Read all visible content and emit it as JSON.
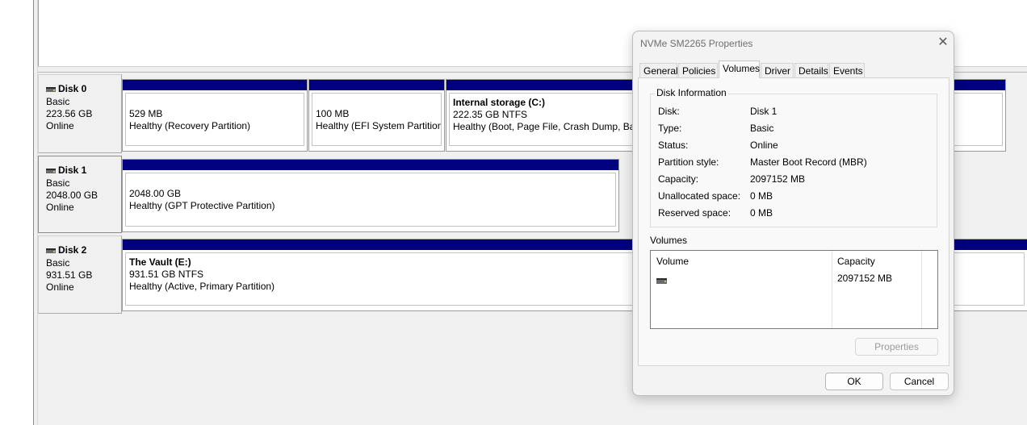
{
  "disks": [
    {
      "name": "Disk 0",
      "type": "Basic",
      "size": "223.56 GB",
      "status": "Online",
      "partitions": [
        {
          "title": "",
          "size": "529 MB",
          "status": "Healthy (Recovery Partition)"
        },
        {
          "title": "",
          "size": "100 MB",
          "status": "Healthy (EFI System Partition)"
        },
        {
          "title": "Internal storage  (C:)",
          "size": "222.35 GB NTFS",
          "status": "Healthy (Boot, Page File, Crash Dump, Basi"
        }
      ]
    },
    {
      "name": "Disk 1",
      "type": "Basic",
      "size": "2048.00 GB",
      "status": "Online",
      "partitions": [
        {
          "title": "",
          "size": "2048.00 GB",
          "status": "Healthy (GPT Protective Partition)"
        }
      ]
    },
    {
      "name": "Disk 2",
      "type": "Basic",
      "size": "931.51 GB",
      "status": "Online",
      "partitions": [
        {
          "title": "The Vault  (E:)",
          "size": "931.51 GB NTFS",
          "status": "Healthy (Active, Primary Partition)"
        }
      ]
    }
  ],
  "dialog": {
    "title": "NVMe SM2265 Properties",
    "close_glyph": "✕",
    "tabs": [
      "General",
      "Policies",
      "Volumes",
      "Driver",
      "Details",
      "Events"
    ],
    "active_tab": "Volumes",
    "disk_info": {
      "group_title": "Disk Information",
      "rows": [
        {
          "label": "Disk:",
          "value": "Disk 1"
        },
        {
          "label": "Type:",
          "value": "Basic"
        },
        {
          "label": "Status:",
          "value": "Online"
        },
        {
          "label": "Partition style:",
          "value": "Master Boot Record (MBR)"
        },
        {
          "label": "Capacity:",
          "value": "2097152 MB"
        },
        {
          "label": "Unallocated space:",
          "value": "0 MB"
        },
        {
          "label": "Reserved space:",
          "value": "0 MB"
        }
      ]
    },
    "volumes": {
      "label": "Volumes",
      "columns": [
        "Volume",
        "Capacity"
      ],
      "rows": [
        {
          "volume": "",
          "capacity": "2097152 MB"
        }
      ]
    },
    "properties_button": "Properties",
    "ok_button": "OK",
    "cancel_button": "Cancel"
  },
  "icons": {
    "disk": "drive-icon"
  },
  "colors": {
    "partition_bar": "#000080",
    "window_bg": "#f0f0f0"
  }
}
